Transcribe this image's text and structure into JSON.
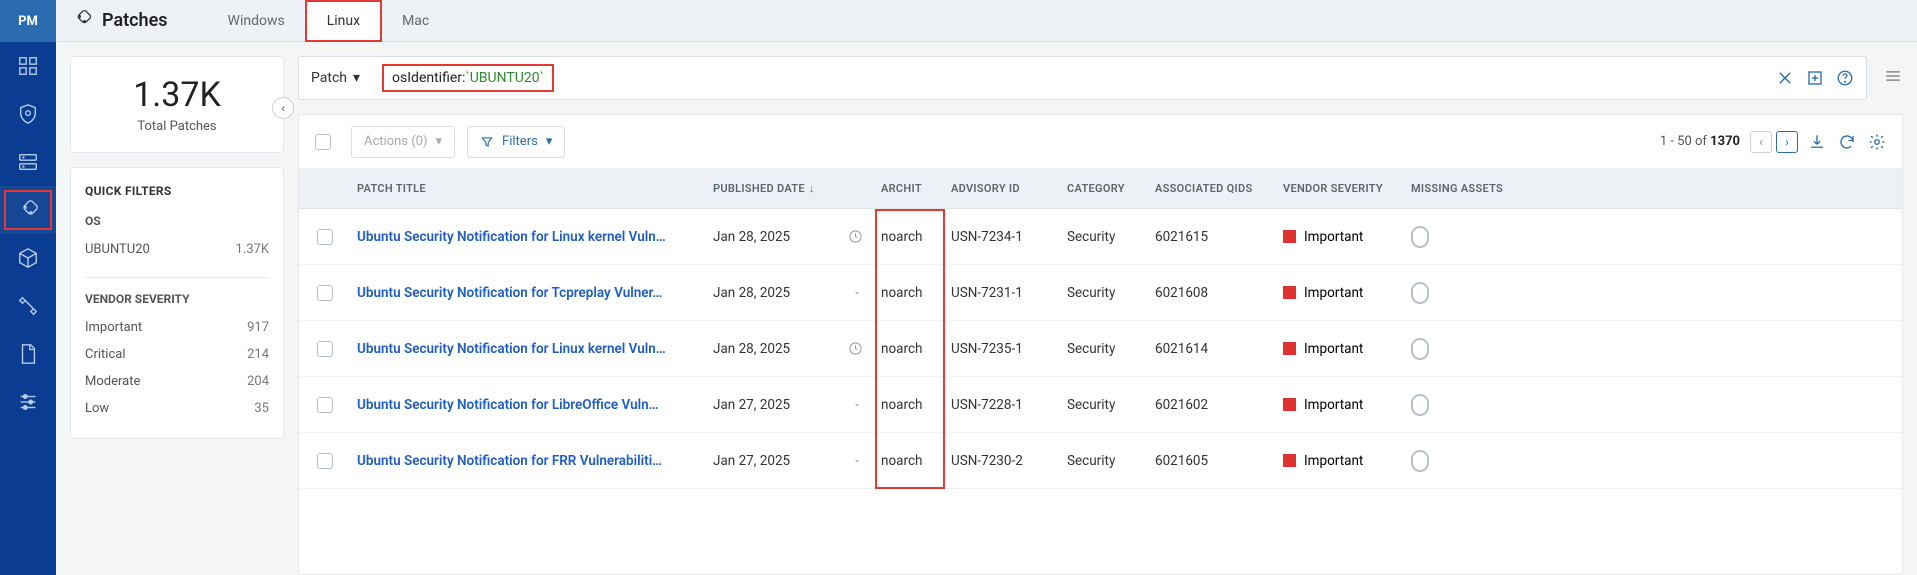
{
  "app": {
    "logo": "PM"
  },
  "nav_items": [
    "dashboard",
    "shield",
    "server",
    "patches",
    "cube",
    "tools",
    "file",
    "settings"
  ],
  "header": {
    "title": "Patches",
    "tabs": [
      {
        "id": "windows",
        "label": "Windows",
        "active": false
      },
      {
        "id": "linux",
        "label": "Linux",
        "active": true,
        "highlighted": true
      },
      {
        "id": "mac",
        "label": "Mac",
        "active": false
      }
    ]
  },
  "stat": {
    "value": "1.37K",
    "label": "Total Patches"
  },
  "quick_filters": {
    "title": "QUICK FILTERS",
    "groups": [
      {
        "title": "OS",
        "items": [
          {
            "label": "UBUNTU20",
            "count": "1.37K"
          }
        ]
      },
      {
        "title": "VENDOR SEVERITY",
        "items": [
          {
            "label": "Important",
            "count": "917"
          },
          {
            "label": "Critical",
            "count": "214"
          },
          {
            "label": "Moderate",
            "count": "204"
          },
          {
            "label": "Low",
            "count": "35"
          }
        ]
      }
    ]
  },
  "search": {
    "scope": "Patch",
    "query_key": "osIdentifier:",
    "query_val": "`UBUNTU20`"
  },
  "toolbar": {
    "actions_label": "Actions (0)",
    "filters_label": "Filters",
    "page_prefix": "1 - 50 of ",
    "total": "1370"
  },
  "columns": {
    "title": "PATCH TITLE",
    "date": "PUBLISHED DATE",
    "arch": "ARCHIT",
    "adv": "ADVISORY ID",
    "cat": "CATEGORY",
    "qid": "ASSOCIATED QIDS",
    "sev": "VENDOR SEVERITY",
    "miss": "MISSING ASSETS"
  },
  "rows": [
    {
      "title": "Ubuntu Security Notification for Linux kernel Vuln…",
      "date": "Jan 28, 2025",
      "clock": true,
      "arch": "noarch",
      "adv": "USN-7234-1",
      "cat": "Security",
      "qid": "6021615",
      "sev_label": "Important",
      "sev_color": "#e03131"
    },
    {
      "title": "Ubuntu Security Notification for Tcpreplay Vulner…",
      "date": "Jan 28, 2025",
      "clock": false,
      "arch": "noarch",
      "adv": "USN-7231-1",
      "cat": "Security",
      "qid": "6021608",
      "sev_label": "Important",
      "sev_color": "#e03131"
    },
    {
      "title": "Ubuntu Security Notification for Linux kernel Vuln…",
      "date": "Jan 28, 2025",
      "clock": true,
      "arch": "noarch",
      "adv": "USN-7235-1",
      "cat": "Security",
      "qid": "6021614",
      "sev_label": "Important",
      "sev_color": "#e03131"
    },
    {
      "title": "Ubuntu Security Notification for LibreOffice Vuln…",
      "date": "Jan 27, 2025",
      "clock": false,
      "arch": "noarch",
      "adv": "USN-7228-1",
      "cat": "Security",
      "qid": "6021602",
      "sev_label": "Important",
      "sev_color": "#e03131"
    },
    {
      "title": "Ubuntu Security Notification for FRR Vulnerabiliti…",
      "date": "Jan 27, 2025",
      "clock": false,
      "arch": "noarch",
      "adv": "USN-7230-2",
      "cat": "Security",
      "qid": "6021605",
      "sev_label": "Important",
      "sev_color": "#e03131"
    }
  ]
}
